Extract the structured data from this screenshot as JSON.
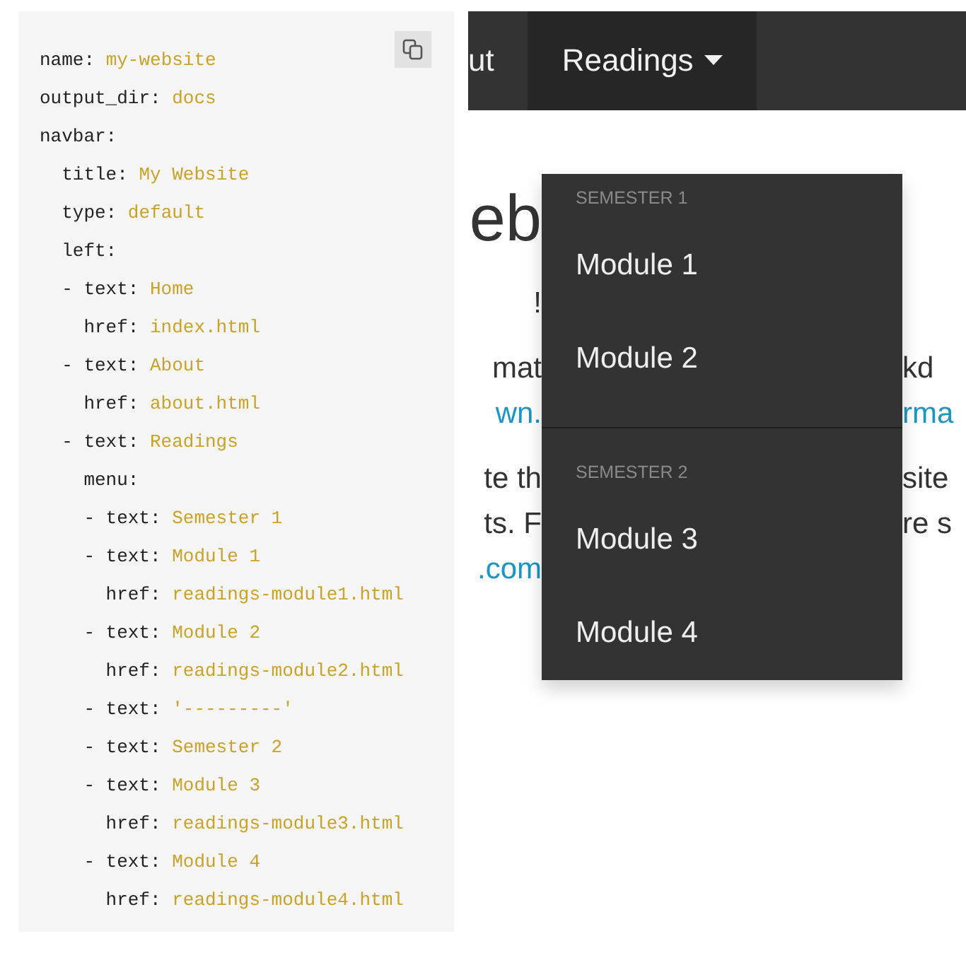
{
  "code": {
    "lines": [
      {
        "key": "name:",
        "value": "my-website"
      },
      {
        "key": "output_dir:",
        "value": "docs"
      },
      {
        "key": "navbar:",
        "children": [
          {
            "key": "title:",
            "value": "My Website"
          },
          {
            "key": "type:",
            "value": "default"
          },
          {
            "key": "left:",
            "items": [
              {
                "marker": "-",
                "lines": [
                  {
                    "key": "text:",
                    "value": "Home"
                  },
                  {
                    "key": "href:",
                    "value": "index.html"
                  }
                ]
              },
              {
                "marker": "-",
                "lines": [
                  {
                    "key": "text:",
                    "value": "About"
                  },
                  {
                    "key": "href:",
                    "value": "about.html"
                  }
                ]
              },
              {
                "marker": "-",
                "lines": [
                  {
                    "key": "text:",
                    "value": "Readings"
                  },
                  {
                    "key": "menu:",
                    "items": [
                      {
                        "marker": "-",
                        "lines": [
                          {
                            "key": "text:",
                            "value": "Semester 1"
                          }
                        ]
                      },
                      {
                        "marker": "-",
                        "lines": [
                          {
                            "key": "text:",
                            "value": "Module 1"
                          },
                          {
                            "key": "href:",
                            "value": "readings-module1.html"
                          }
                        ]
                      },
                      {
                        "marker": "-",
                        "lines": [
                          {
                            "key": "text:",
                            "value": "Module 2"
                          },
                          {
                            "key": "href:",
                            "value": "readings-module2.html"
                          }
                        ]
                      },
                      {
                        "marker": "-",
                        "lines": [
                          {
                            "key": "text:",
                            "value": "'---------'"
                          }
                        ]
                      },
                      {
                        "marker": "-",
                        "lines": [
                          {
                            "key": "text:",
                            "value": "Semester 2"
                          }
                        ]
                      },
                      {
                        "marker": "-",
                        "lines": [
                          {
                            "key": "text:",
                            "value": "Module 3"
                          },
                          {
                            "key": "href:",
                            "value": "readings-module3.html"
                          }
                        ]
                      },
                      {
                        "marker": "-",
                        "lines": [
                          {
                            "key": "text:",
                            "value": "Module 4"
                          },
                          {
                            "key": "href:",
                            "value": "readings-module4.html"
                          }
                        ]
                      }
                    ]
                  }
                ]
              }
            ]
          }
        ]
      }
    ]
  },
  "navbar": {
    "items": [
      {
        "label": "ut",
        "selected": false,
        "dropdown": false
      },
      {
        "label": "Readings",
        "selected": true,
        "dropdown": true
      }
    ]
  },
  "dropdown": {
    "items": [
      {
        "kind": "header",
        "label": "SEMESTER 1"
      },
      {
        "kind": "link",
        "label": "Module 1"
      },
      {
        "kind": "link",
        "label": "Module 2"
      },
      {
        "kind": "divider"
      },
      {
        "kind": "header",
        "label": "SEMESTER 2"
      },
      {
        "kind": "link",
        "label": "Module 3"
      },
      {
        "kind": "link",
        "label": "Module 4"
      }
    ]
  },
  "content": [
    {
      "kind": "heading",
      "lines": [
        {
          "left": "eb"
        }
      ]
    },
    {
      "kind": "paragraph",
      "lines": [
        {
          "left": "!"
        }
      ]
    },
    {
      "kind": "paragraph",
      "lines": [
        {
          "left": "mat",
          "right": "kd",
          "link": false
        },
        {
          "left": "wn.",
          "right": "rma",
          "link": true
        }
      ]
    },
    {
      "kind": "paragraph",
      "lines": [
        {
          "left": "te th",
          "right": "site",
          "link": false
        },
        {
          "left": "ts. F",
          "right": "re s",
          "link": false
        },
        {
          "left": ".com",
          "link": true
        }
      ]
    }
  ]
}
